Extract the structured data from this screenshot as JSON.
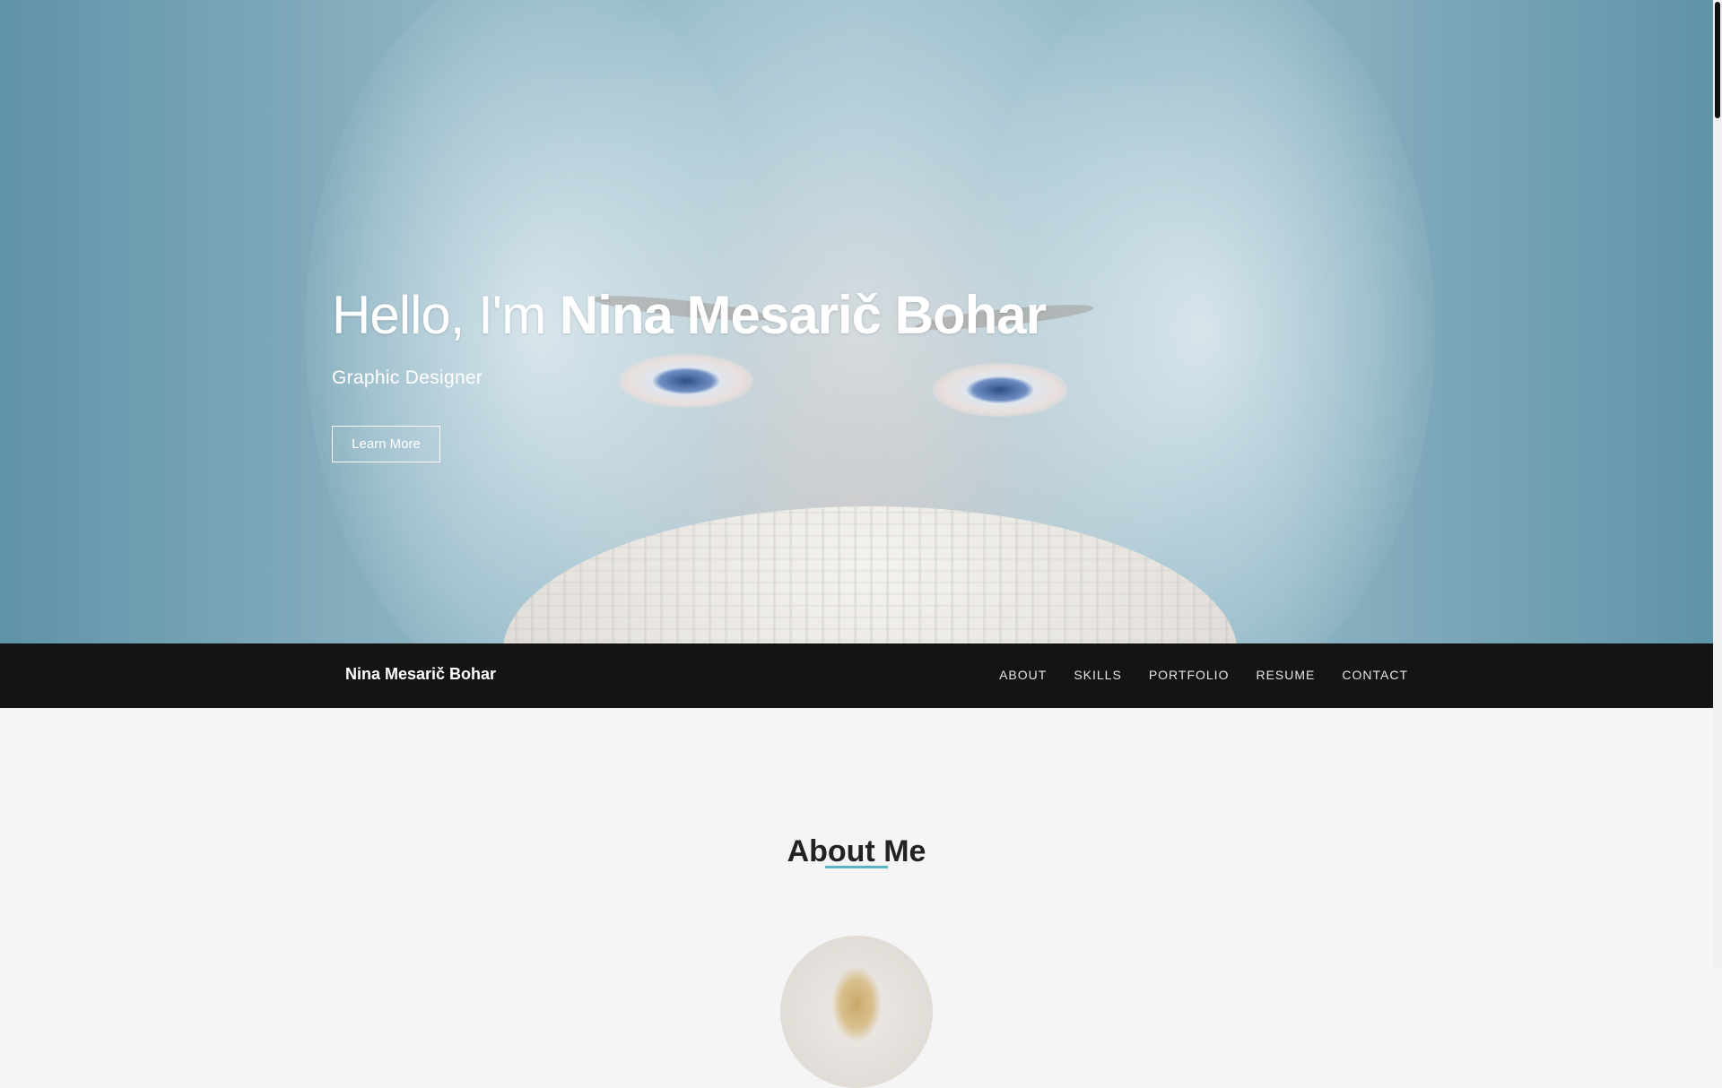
{
  "hero": {
    "greeting": "Hello, I'm ",
    "name": "Nina Mesarič Bohar",
    "subtitle": "Graphic Designer",
    "button_label": "Learn More"
  },
  "nav": {
    "brand": "Nina Mesarič Bohar",
    "links": [
      "ABOUT",
      "SKILLS",
      "PORTFOLIO",
      "RESUME",
      "CONTACT"
    ]
  },
  "about": {
    "title": "About Me"
  },
  "colors": {
    "accent": "#5bb5c9",
    "navbar_bg": "#141414",
    "page_bg": "#f5f5f5"
  }
}
